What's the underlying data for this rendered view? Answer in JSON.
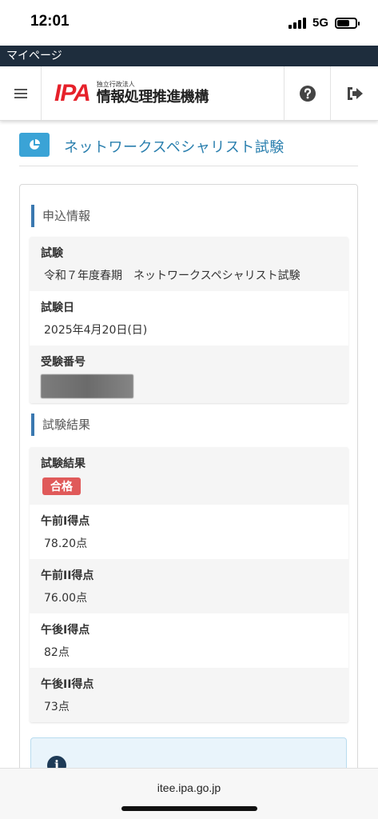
{
  "status_bar": {
    "time": "12:01",
    "network": "5G"
  },
  "mypage_bar": {
    "label": "マイページ"
  },
  "header": {
    "logo_mark": "IPA",
    "org_small": "独立行政法人",
    "org_name": "情報処理推進機構",
    "help_icon": "question-circle-icon",
    "logout_icon": "sign-out-icon"
  },
  "page": {
    "title": "ネットワークスペシャリスト試験"
  },
  "application": {
    "heading": "申込情報",
    "rows": [
      {
        "label": "試験",
        "value": "令和７年度春期　ネットワークスペシャリスト試験"
      },
      {
        "label": "試験日",
        "value": "2025年4月20日(日)"
      },
      {
        "label": "受験番号",
        "value": ""
      }
    ]
  },
  "results": {
    "heading": "試験結果",
    "result_label": "試験結果",
    "result_badge": "合格",
    "rows": [
      {
        "label": "午前I得点",
        "value": "78.20点"
      },
      {
        "label": "午前II得点",
        "value": "76.00点"
      },
      {
        "label": "午後I得点",
        "value": "82点"
      },
      {
        "label": "午後II得点",
        "value": "73点"
      }
    ]
  },
  "browser": {
    "url": "itee.ipa.go.jp"
  },
  "colors": {
    "accent": "#2a7fae",
    "header_dark": "#1e2d3d",
    "pass": "#e05a5a",
    "logo_red": "#e6212a"
  }
}
